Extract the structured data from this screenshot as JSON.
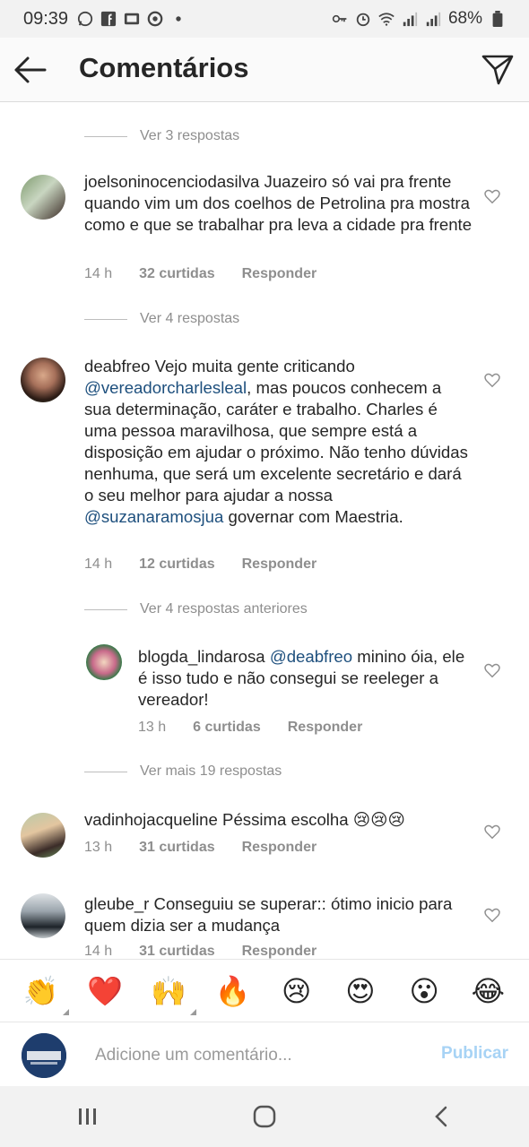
{
  "status_bar": {
    "time": "09:39",
    "battery": "68%"
  },
  "header": {
    "title": "Comentários"
  },
  "threads": {
    "t1_toggle": "Ver 3 respostas",
    "t2_toggle": "Ver 4 respostas",
    "t3_toggle": "Ver 4 respostas anteriores",
    "t4_toggle": "Ver mais 19 respostas"
  },
  "comments": [
    {
      "username": "joelsoninocenciodasilva",
      "text": " Juazeiro só vai pra frente quando vim um dos coelhos de Petrolina pra mostra como e que  se trabalhar pra leva a cidade pra frente",
      "time": "14 h",
      "likes": "32 curtidas",
      "reply": "Responder"
    },
    {
      "username": "deabfreo",
      "text_before": " Vejo muita gente criticando ",
      "mention1": "@vereadorcharlesleal",
      "text_middle": ", mas poucos conhecem a sua determinação, caráter e trabalho. Charles é uma pessoa maravilhosa, que sempre está a disposição em ajudar o próximo.  Não tenho dúvidas nenhuma, que será um excelente secretário e dará o seu melhor para ajudar a nossa ",
      "mention2": "@suzanaramosjua",
      "text_after": " governar com Maestria.",
      "time": "14 h",
      "likes": "12 curtidas",
      "reply": "Responder"
    },
    {
      "username": "blogda_lindarosa",
      "mention": "@deabfreo",
      "text": " minino óia, ele é isso tudo e não consegui se reeleger a vereador!",
      "time": "13 h",
      "likes": "6 curtidas",
      "reply": "Responder"
    },
    {
      "username": "vadinhojacqueline",
      "text": " Péssima escolha 😢😢😢",
      "time": "13 h",
      "likes": "31 curtidas",
      "reply": "Responder"
    },
    {
      "username": "gleube_r",
      "text": " Conseguiu se superar:: ótimo inicio para quem dizia ser a mudança",
      "time": "14 h",
      "likes": "31 curtidas",
      "reply": "Responder"
    }
  ],
  "emoji_bar": [
    "👏",
    "❤️",
    "🙌",
    "🔥",
    "😢",
    "😍",
    "😮",
    "😂"
  ],
  "input": {
    "placeholder": "Adicione um comentário...",
    "publish": "Publicar"
  }
}
